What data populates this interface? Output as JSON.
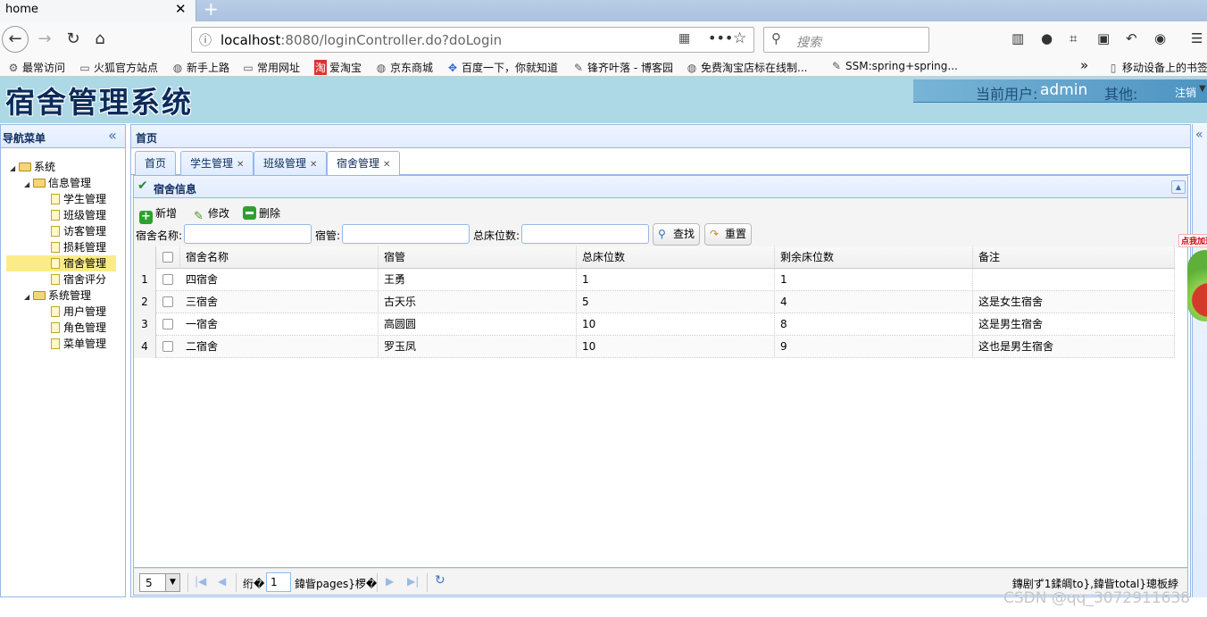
{
  "browser": {
    "tab_title": "home",
    "tab_close": "✕",
    "new_tab": "+",
    "url_host": "localhost",
    "url_rest": ":8080/loginController.do?doLogin",
    "search_placeholder": "搜索",
    "bookmarks": [
      {
        "label": "最常访问",
        "icon": "gear-icon"
      },
      {
        "label": "火狐官方站点",
        "icon": "folder-icon"
      },
      {
        "label": "新手上路",
        "icon": "globe-icon"
      },
      {
        "label": "常用网址",
        "icon": "folder-icon"
      },
      {
        "label": "爱淘宝",
        "icon": "taobao-icon"
      },
      {
        "label": "京东商城",
        "icon": "globe-icon"
      },
      {
        "label": "百度一下，你就知道",
        "icon": "baidu-icon"
      },
      {
        "label": "锋齐叶落 - 博客园",
        "icon": "blog-icon"
      },
      {
        "label": "免费淘宝店标在线制...",
        "icon": "globe-icon"
      },
      {
        "label": "SSM:spring+spring...",
        "icon": "blog-icon"
      }
    ],
    "bookmarks_overflow": "»",
    "mobile_bookmarks": "移动设备上的书签"
  },
  "app": {
    "title": "宿舍管理系统",
    "current_user_label": "当前用户:",
    "current_user": "admin",
    "other_label": "其他:",
    "logout": "注销"
  },
  "nav": {
    "title": "导航菜单",
    "tree": [
      {
        "label": "系统",
        "level": 0,
        "type": "folder"
      },
      {
        "label": "信息管理",
        "level": 1,
        "type": "folder"
      },
      {
        "label": "学生管理",
        "level": 2,
        "type": "file"
      },
      {
        "label": "班级管理",
        "level": 2,
        "type": "file"
      },
      {
        "label": "访客管理",
        "level": 2,
        "type": "file"
      },
      {
        "label": "损耗管理",
        "level": 2,
        "type": "file"
      },
      {
        "label": "宿舍管理",
        "level": 2,
        "type": "file",
        "selected": true
      },
      {
        "label": "宿舍评分",
        "level": 2,
        "type": "file"
      },
      {
        "label": "系统管理",
        "level": 1,
        "type": "folder"
      },
      {
        "label": "用户管理",
        "level": 2,
        "type": "file"
      },
      {
        "label": "角色管理",
        "level": 2,
        "type": "file"
      },
      {
        "label": "菜单管理",
        "level": 2,
        "type": "file"
      }
    ]
  },
  "center": {
    "title": "首页",
    "tabs": [
      {
        "label": "首页",
        "closable": false
      },
      {
        "label": "学生管理",
        "closable": true
      },
      {
        "label": "班级管理",
        "closable": true
      },
      {
        "label": "宿舍管理",
        "closable": true,
        "active": true
      }
    ]
  },
  "panel": {
    "title": "宿舍信息",
    "toolbar": {
      "add": "新增",
      "edit": "修改",
      "delete": "删除"
    },
    "filters": {
      "name_label": "宿舍名称:",
      "manager_label": "宿管:",
      "beds_label": "总床位数:",
      "search_button": "查找",
      "reset_button": "重置"
    }
  },
  "grid": {
    "columns": [
      "宿舍名称",
      "宿管",
      "总床位数",
      "剩余床位数",
      "备注"
    ],
    "rows": [
      [
        "四宿舍",
        "王勇",
        "1",
        "1",
        ""
      ],
      [
        "三宿舍",
        "古天乐",
        "5",
        "4",
        "这是女生宿舍"
      ],
      [
        "一宿舍",
        "高圆圆",
        "10",
        "8",
        "这是男生宿舍"
      ],
      [
        "二宿舍",
        "罗玉凤",
        "10",
        "9",
        "这也是男生宿舍"
      ]
    ]
  },
  "pager": {
    "page_size": "5",
    "before_text": "绗�",
    "page_number": "1",
    "after_text": "鍏眥pages}椤�",
    "info": "鏄剧ず1鍒皗to},鍏眥total}璁板綍"
  },
  "float_ad": "点我加速",
  "watermark": "CSDN @qq_3072911638"
}
